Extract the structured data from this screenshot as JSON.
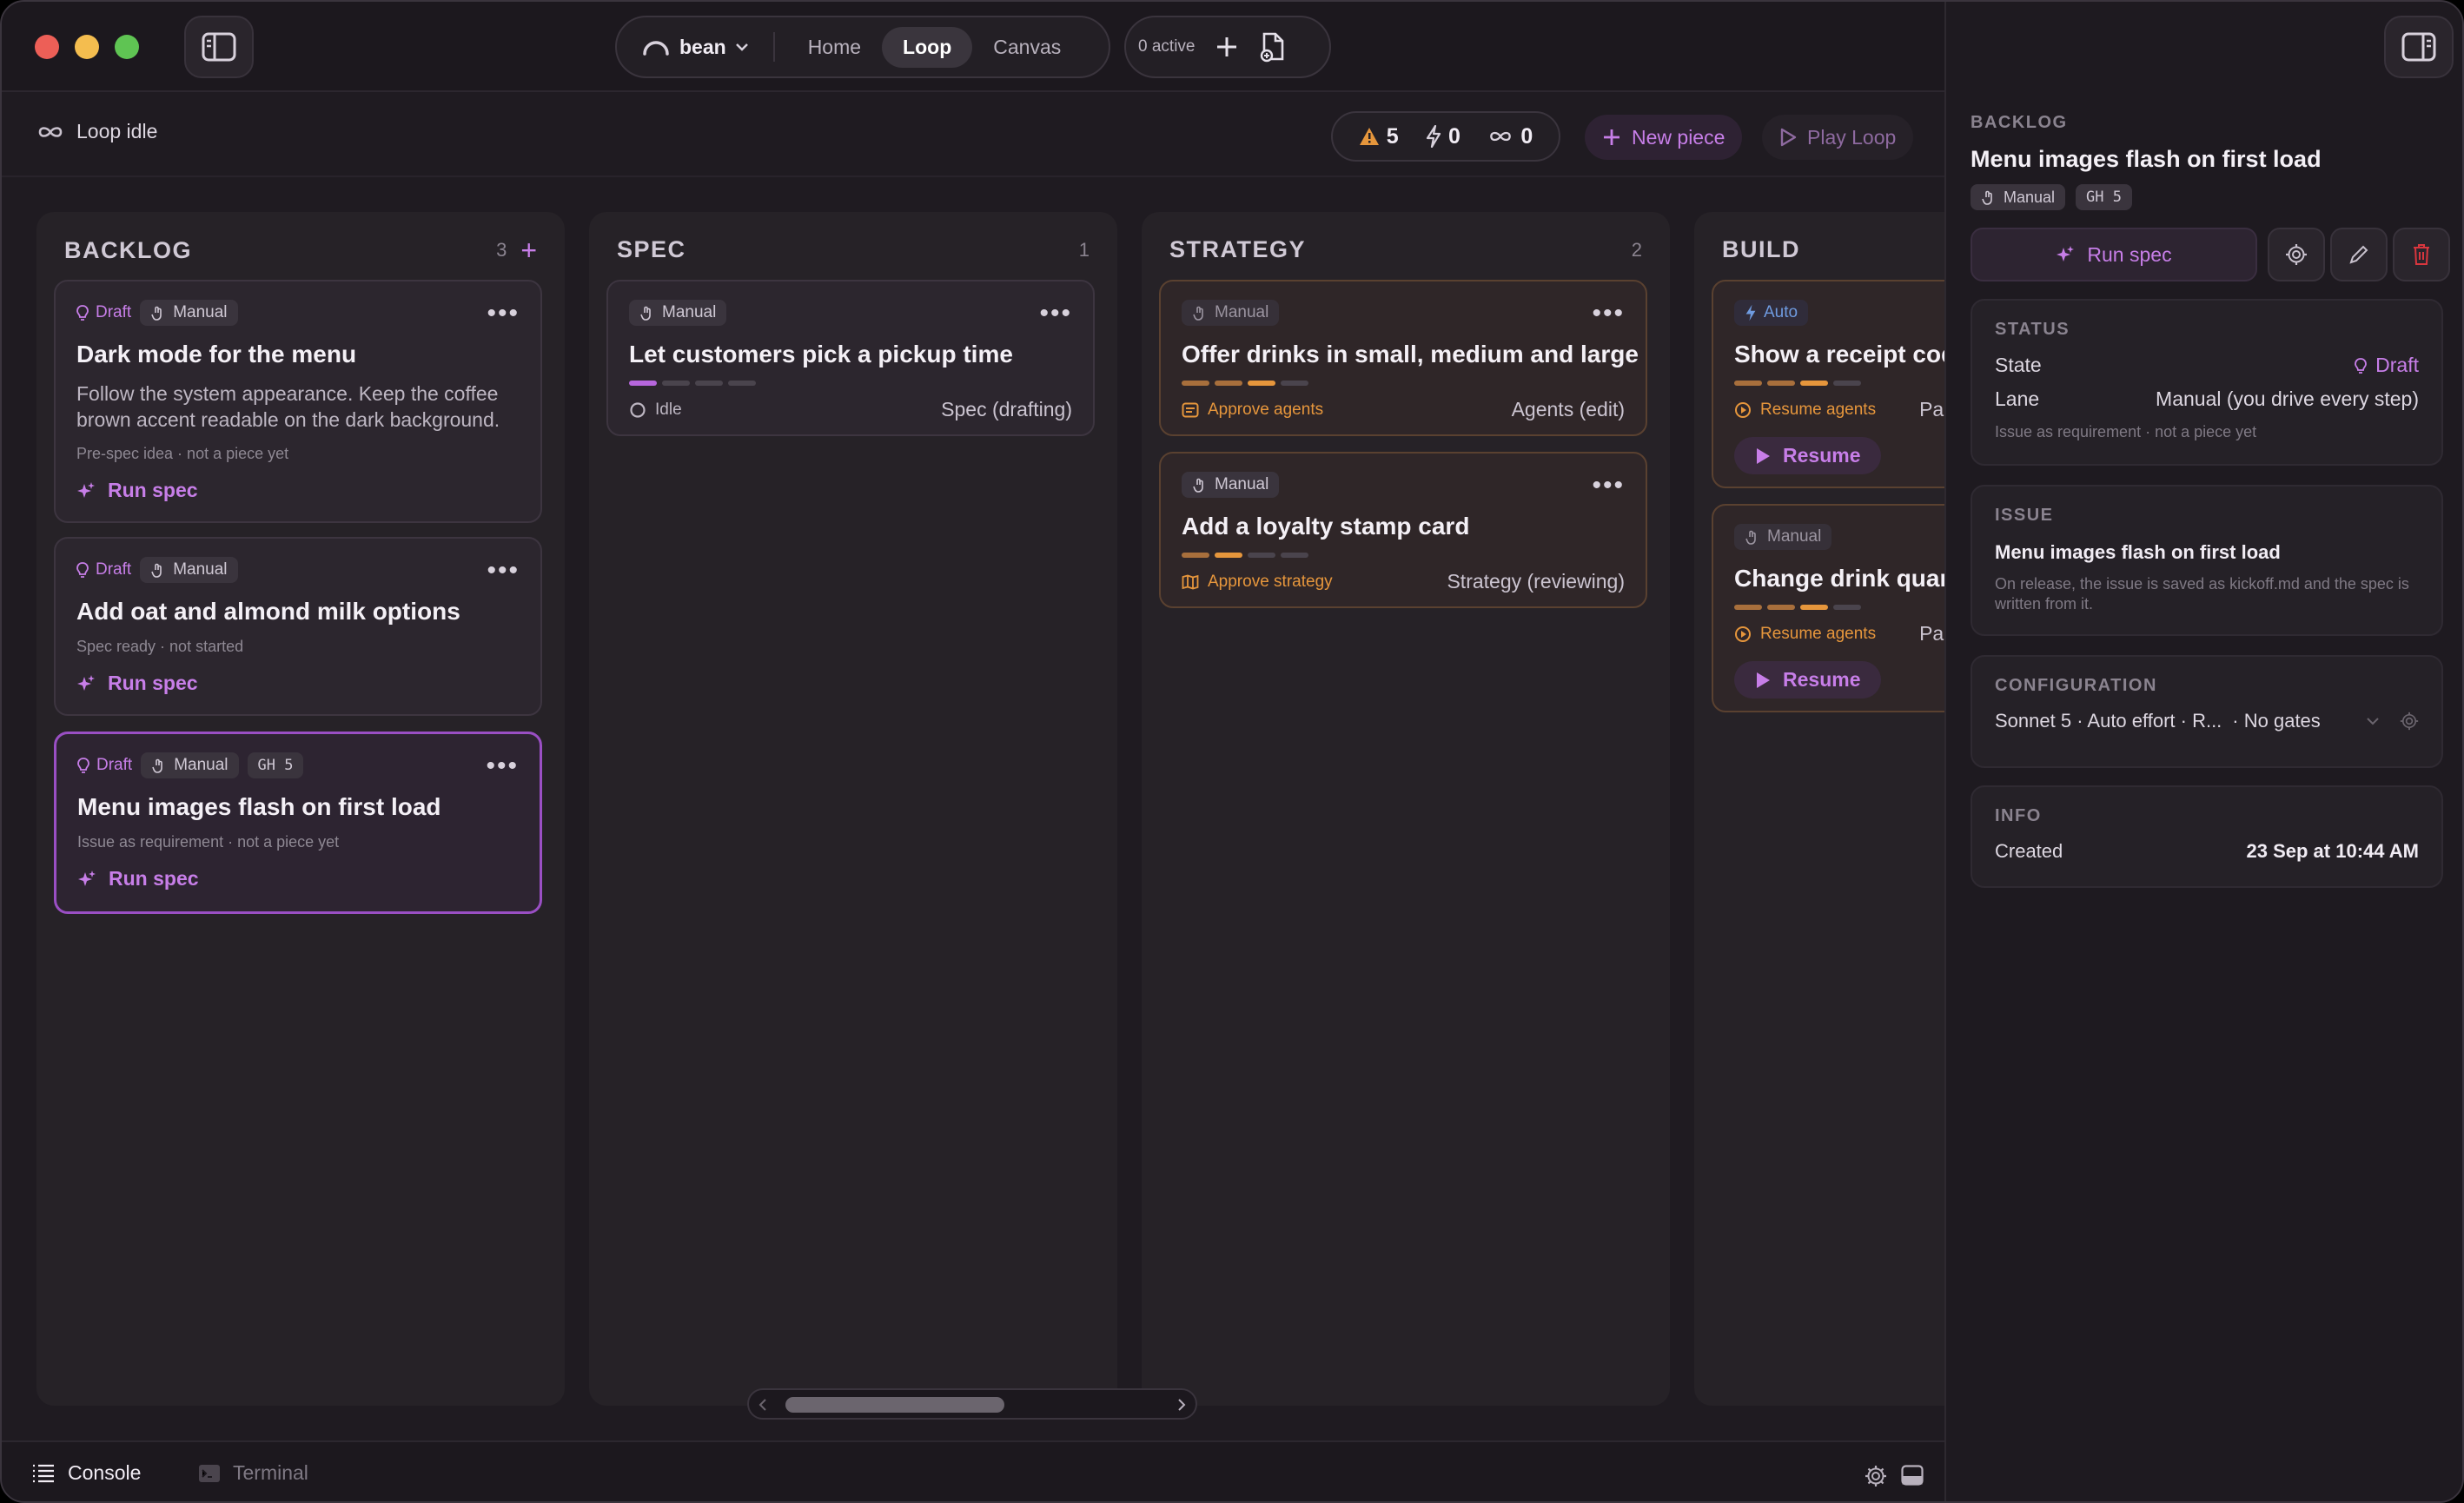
{
  "colors": {
    "accent": "#c77ee8",
    "warning": "#e6963c",
    "auto": "#6f9be0",
    "danger": "#d9363e"
  },
  "topbar": {
    "workspace": "bean",
    "tabs": [
      "Home",
      "Loop",
      "Canvas"
    ],
    "active_tab": "Loop",
    "active_count": "0 active"
  },
  "subbar": {
    "loop_status": "Loop idle",
    "counters": {
      "warnings": "5",
      "bolts": "0",
      "loops": "0"
    },
    "new_piece": "New piece",
    "play_loop": "Play Loop"
  },
  "columns": {
    "backlog": {
      "title": "BACKLOG",
      "count": "3",
      "cards": [
        {
          "state": "Draft",
          "mode": "Manual",
          "title": "Dark mode for the menu",
          "desc": "Follow the system appearance. Keep the coffee brown accent readable on the dark background.",
          "meta": "Pre-spec idea · not a piece yet",
          "action": "Run spec"
        },
        {
          "state": "Draft",
          "mode": "Manual",
          "title": "Add oat and almond milk options",
          "meta": "Spec ready · not started",
          "action": "Run spec"
        },
        {
          "state": "Draft",
          "mode": "Manual",
          "gh": "GH 5",
          "title": "Menu images flash on first load",
          "meta": "Issue as requirement · not a piece yet",
          "action": "Run spec"
        }
      ]
    },
    "spec": {
      "title": "SPEC",
      "count": "1",
      "cards": [
        {
          "mode": "Manual",
          "title": "Let customers pick a pickup time",
          "status": "Idle",
          "phase": "Spec (drafting)"
        }
      ]
    },
    "strategy": {
      "title": "STRATEGY",
      "count": "2",
      "cards": [
        {
          "mode": "Manual",
          "title": "Offer drinks in small, medium and large",
          "status": "Approve agents",
          "phase": "Agents (edit)"
        },
        {
          "mode": "Manual",
          "title": "Add a loyalty stamp card",
          "status": "Approve strategy",
          "phase": "Strategy (reviewing)"
        }
      ]
    },
    "build": {
      "title": "BUILD",
      "cards": [
        {
          "mode": "Auto",
          "title": "Show a receipt code",
          "status": "Resume agents",
          "phase": "Pau",
          "action": "Resume"
        },
        {
          "mode": "Manual",
          "title": "Change drink quantity",
          "status": "Resume agents",
          "phase": "Pau",
          "action": "Resume"
        }
      ]
    }
  },
  "bottombar": {
    "console": "Console",
    "terminal": "Terminal"
  },
  "panel": {
    "section": "BACKLOG",
    "title": "Menu images flash on first load",
    "mode": "Manual",
    "gh": "GH 5",
    "run_spec": "Run spec",
    "status": {
      "label": "STATUS",
      "state_key": "State",
      "state_val": "Draft",
      "lane_key": "Lane",
      "lane_val": "Manual (you drive every step)",
      "note": "Issue as requirement · not a piece yet"
    },
    "issue": {
      "label": "ISSUE",
      "title": "Menu images flash on first load",
      "note": "On release, the issue is saved as kickoff.md and the spec is written from it."
    },
    "configuration": {
      "label": "CONFIGURATION",
      "summary": "Sonnet 5 · Auto effort · R...",
      "gates": "· No gates"
    },
    "info": {
      "label": "INFO",
      "created_key": "Created",
      "created_val": "23 Sep at 10:44 AM"
    }
  }
}
